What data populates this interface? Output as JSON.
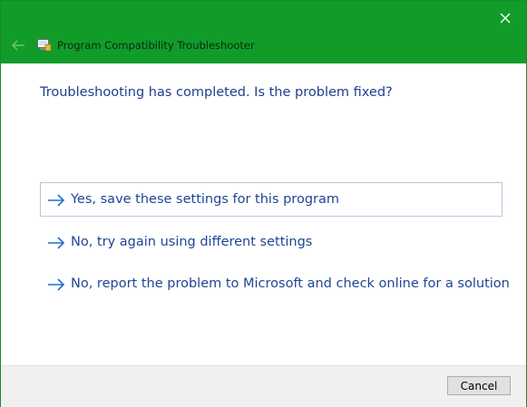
{
  "window": {
    "title": "Program Compatibility Troubleshooter",
    "accent_color": "#119c2a",
    "close_icon": "close-icon",
    "back_icon": "back-arrow-icon",
    "app_icon": "troubleshooter-icon"
  },
  "main": {
    "question": "Troubleshooting has completed.  Is the problem fixed?",
    "options": [
      {
        "label": "Yes, save these settings for this program",
        "icon": "arrow-right-icon",
        "focused": true
      },
      {
        "label": "No, try again using different settings",
        "icon": "arrow-right-icon",
        "focused": false
      },
      {
        "label": "No, report the problem to Microsoft and check online for a solution",
        "icon": "arrow-right-icon",
        "focused": false
      }
    ]
  },
  "footer": {
    "cancel_label": "Cancel"
  }
}
